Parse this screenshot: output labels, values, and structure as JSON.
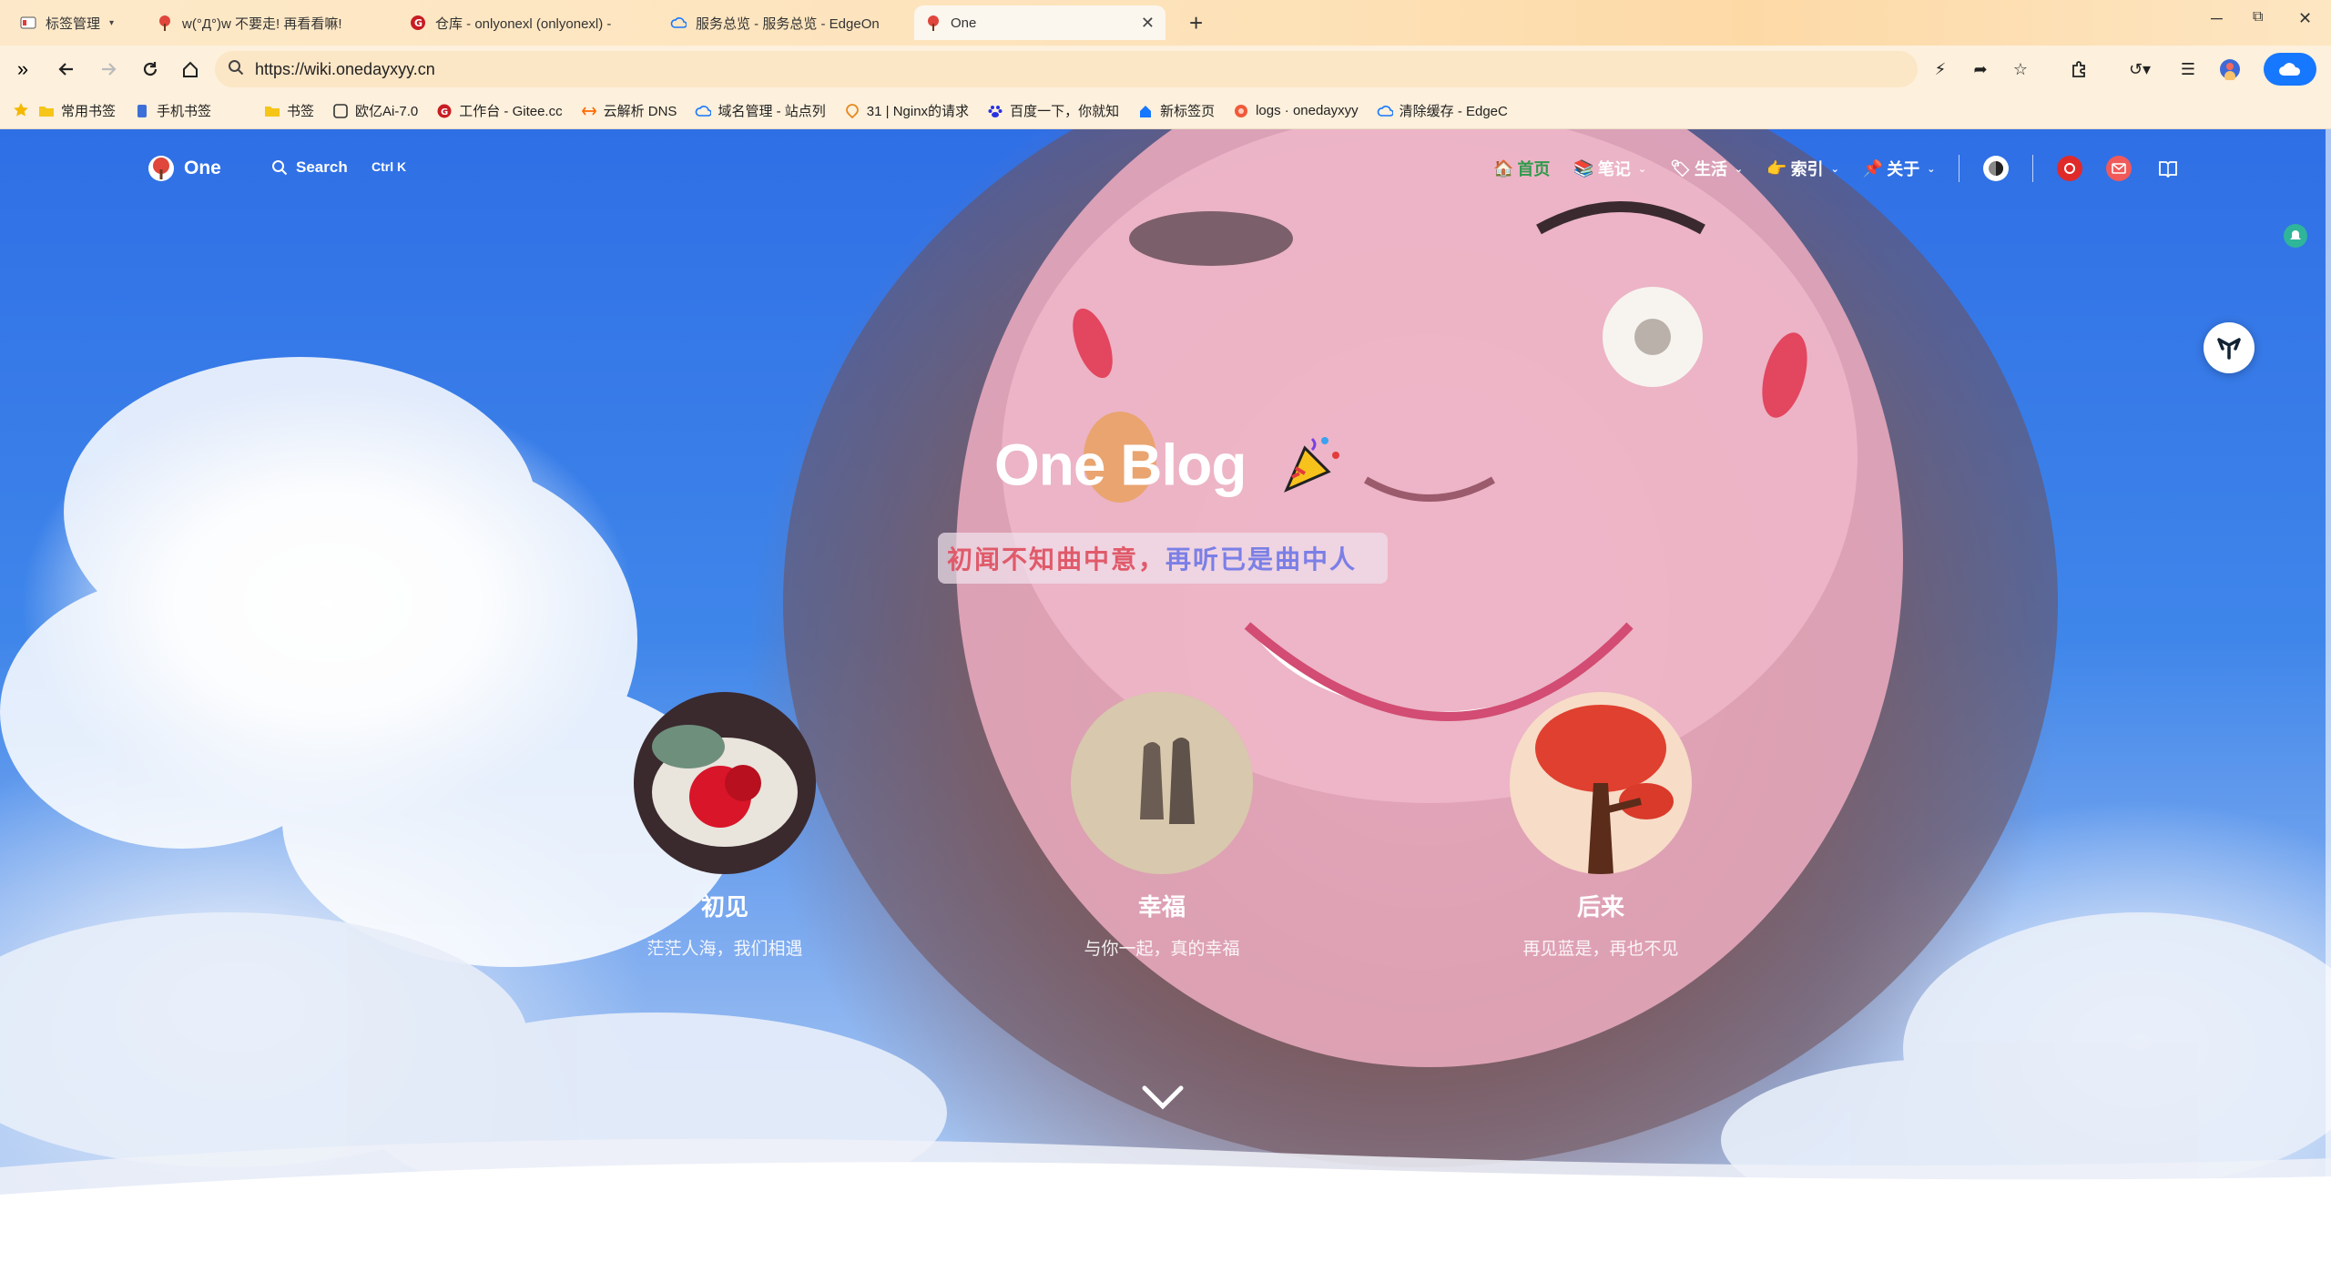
{
  "browser": {
    "tabs": [
      {
        "title": "标签管理",
        "icon": "tab-manager-icon",
        "active": false
      },
      {
        "title": "w(°Д°)w 不要走! 再看看嘛!",
        "icon": "flower-favicon",
        "active": false
      },
      {
        "title": "仓库 - onlyonexl (onlyonexl) -",
        "icon": "gitee-favicon",
        "active": false
      },
      {
        "title": "服务总览 - 服务总览 - EdgeOn",
        "icon": "cloud-favicon",
        "active": false
      },
      {
        "title": "One",
        "icon": "flower-favicon",
        "active": true
      }
    ],
    "url": "https://wiki.onedayxyy.cn",
    "bookmarks": [
      {
        "label": "常用书签",
        "icon": "folder-icon"
      },
      {
        "label": "手机书签",
        "icon": "phone-bookmark-icon"
      },
      {
        "label": "书签",
        "icon": "folder-icon"
      },
      {
        "label": "欧亿Ai-7.0",
        "icon": "ai-icon"
      },
      {
        "label": "工作台 - Gitee.cc",
        "icon": "gitee-favicon"
      },
      {
        "label": "云解析 DNS",
        "icon": "dns-icon"
      },
      {
        "label": "域名管理 - 站点列",
        "icon": "cloud-favicon"
      },
      {
        "label": "31 | Nginx的请求",
        "icon": "geek-icon"
      },
      {
        "label": "百度一下，你就知",
        "icon": "baidu-icon"
      },
      {
        "label": "新标签页",
        "icon": "home-icon"
      },
      {
        "label": "logs · onedayxyy",
        "icon": "logs-icon"
      },
      {
        "label": "清除缓存 - EdgeC",
        "icon": "cloud-favicon"
      }
    ],
    "accent_color": "#1677ff"
  },
  "site": {
    "logo_text": "One",
    "search_label": "Search",
    "search_shortcut": "Ctrl K",
    "nav": [
      {
        "label": "首页",
        "icon": "home-emoji-icon",
        "dropdown": false
      },
      {
        "label": "笔记",
        "icon": "books-emoji-icon",
        "dropdown": true
      },
      {
        "label": "生活",
        "icon": "tag-emoji-icon",
        "dropdown": true
      },
      {
        "label": "索引",
        "icon": "pointer-emoji-icon",
        "dropdown": true
      },
      {
        "label": "关于",
        "icon": "pushpin-emoji-icon",
        "dropdown": true
      }
    ],
    "hero": {
      "title": "One Blog",
      "subtitle_part1": "初闻不知曲中意，",
      "subtitle_part2": "再听已是曲中人"
    },
    "cards": [
      {
        "title": "初见",
        "subtitle": "茫茫人海，我们相遇"
      },
      {
        "title": "幸福",
        "subtitle": "与你一起，真的幸福"
      },
      {
        "title": "后来",
        "subtitle": "再见蓝是，再也不见"
      }
    ]
  }
}
